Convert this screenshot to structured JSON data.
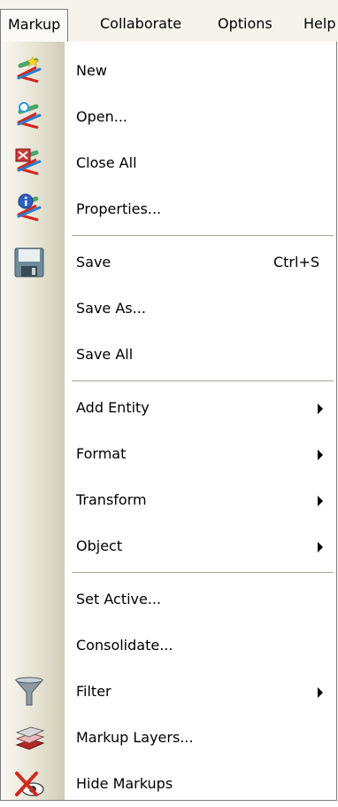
{
  "menubar": {
    "items": [
      {
        "label": "Markup"
      },
      {
        "label": "Collaborate"
      },
      {
        "label": "Options"
      },
      {
        "label": "Help"
      }
    ]
  },
  "menu": {
    "items": [
      {
        "label": "New",
        "icon": "new-markup-icon"
      },
      {
        "label": "Open...",
        "icon": "open-markup-icon"
      },
      {
        "label": "Close All",
        "icon": "close-all-icon"
      },
      {
        "label": "Properties...",
        "icon": "properties-icon"
      },
      {
        "label": "Save",
        "shortcut": "Ctrl+S",
        "icon": "save-icon"
      },
      {
        "label": "Save As..."
      },
      {
        "label": "Save All"
      },
      {
        "label": "Add Entity",
        "submenu": true
      },
      {
        "label": "Format",
        "submenu": true
      },
      {
        "label": "Transform",
        "submenu": true
      },
      {
        "label": "Object",
        "submenu": true
      },
      {
        "label": "Set Active..."
      },
      {
        "label": "Consolidate..."
      },
      {
        "label": "Filter",
        "submenu": true,
        "icon": "filter-icon"
      },
      {
        "label": "Markup Layers...",
        "icon": "layers-icon"
      },
      {
        "label": "Hide Markups",
        "icon": "hide-markups-icon"
      }
    ]
  },
  "colors": {
    "menubar_bg": "#f5f3ec",
    "gutter_edge": "#d0ccb7",
    "separator": "#a8a493"
  }
}
